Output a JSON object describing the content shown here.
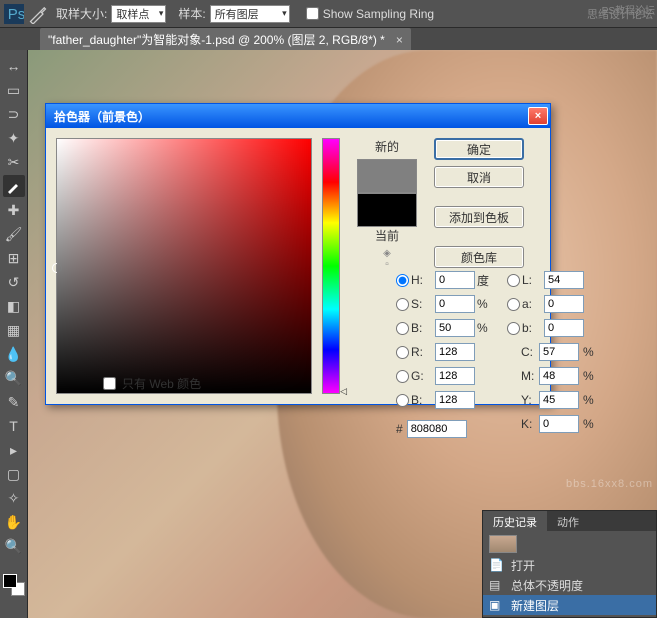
{
  "topbar": {
    "sample_size_label": "取样大小:",
    "sample_size_value": "取样点",
    "sample_label": "样本:",
    "sample_value": "所有图层",
    "show_sampling_ring": "Show Sampling Ring",
    "right_link1": "思绪设计论坛",
    "right_link2": "PS教程论坛"
  },
  "tab": {
    "title": "\"father_daughter\"为智能对象-1.psd @ 200% (图层 2, RGB/8*) *",
    "close": "×"
  },
  "dialog": {
    "title": "拾色器（前景色）",
    "new_label": "新的",
    "current_label": "当前",
    "ok": "确定",
    "cancel": "取消",
    "add_swatch": "添加到色板",
    "color_lib": "颜色库",
    "web_only": "只有 Web 颜色",
    "hsv": {
      "h": "0",
      "s": "0",
      "b": "50"
    },
    "lab": {
      "l": "54",
      "a": "0",
      "b": "0"
    },
    "rgb": {
      "r": "128",
      "g": "128",
      "b": "128"
    },
    "cmyk": {
      "c": "57",
      "m": "48",
      "y": "45",
      "k": "0"
    },
    "hex": "808080",
    "labels": {
      "h": "H:",
      "s": "S:",
      "b": "B:",
      "l": "L:",
      "a": "a:",
      "b2": "b:",
      "r": "R:",
      "g": "G:",
      "bb": "B:",
      "c": "C:",
      "m": "M:",
      "y": "Y:",
      "k": "K:",
      "deg": "度",
      "pct": "%"
    }
  },
  "history": {
    "tab1": "历史记录",
    "tab2": "动作",
    "items": [
      "打开",
      "总体不透明度",
      "新建图层"
    ]
  },
  "watermark": "bbs.16xx8.com",
  "watermark2": "bbs.16xx8.com"
}
